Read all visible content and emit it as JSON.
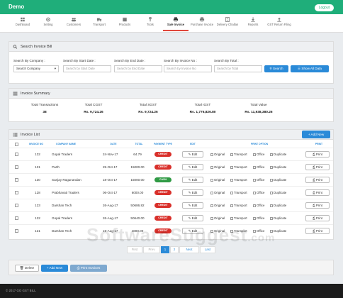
{
  "app": {
    "title": "Demo",
    "logout_label": "Logout"
  },
  "nav": [
    {
      "label": "Dashboard",
      "icon": "dashboard-icon"
    },
    {
      "label": "Setting",
      "icon": "gear-icon"
    },
    {
      "label": "Customers",
      "icon": "users-icon"
    },
    {
      "label": "Transport",
      "icon": "truck-icon"
    },
    {
      "label": "Products",
      "icon": "box-icon"
    },
    {
      "label": "Tools",
      "icon": "wrench-icon"
    },
    {
      "label": "Sale Invoice",
      "icon": "print-icon",
      "active": true
    },
    {
      "label": "Purchase Invoice",
      "icon": "print-icon"
    },
    {
      "label": "Delivery Challan",
      "icon": "doc-icon"
    },
    {
      "label": "Reports",
      "icon": "download-icon"
    },
    {
      "label": "GST Return Filing",
      "icon": "upload-icon"
    }
  ],
  "search": {
    "title": "Search Invoice Bill",
    "company_label": "Search By Company :",
    "company_value": "Search Company",
    "start_label": "Search By Start Date :",
    "start_placeholder": "Search by Start Date",
    "end_label": "Search By End Date :",
    "end_placeholder": "Search by End Date",
    "invoice_label": "Search By Invoice No :",
    "invoice_placeholder": "Search by Invoice No",
    "total_label": "Search By Total :",
    "total_placeholder": "Search by Total",
    "search_button": "Search",
    "show_all_button": "Show All Data"
  },
  "summary": {
    "title": "Invoice Summary",
    "items": [
      {
        "label": "Total Transactions",
        "value": "38"
      },
      {
        "label": "Total CGST",
        "value": "Rs. 9,724.26"
      },
      {
        "label": "Total SGST",
        "value": "Rs. 9,724.26"
      },
      {
        "label": "Total IGST",
        "value": "Rs. 1,776,826.80"
      },
      {
        "label": "Total Value",
        "value": "Rs. 11,938,380.26"
      }
    ]
  },
  "list": {
    "title": "Invoice List",
    "add_new_label": "+ Add New",
    "columns": [
      "INVOICE NO",
      "COMPANY NAME",
      "DATE",
      "TOTAL",
      "PAYMENT TYPE",
      "EDIT",
      "PRINT OPTION",
      "PRINT"
    ],
    "edit_label": "Edit",
    "print_label": "Print",
    "print_options": [
      "Original",
      "Transport",
      "Office",
      "Duplicate"
    ],
    "rows": [
      {
        "no": "132",
        "company": "Gopal Traders",
        "date": "24-Nov-17",
        "total": "64.79",
        "payment": "CREDIT"
      },
      {
        "no": "131",
        "company": "Parth",
        "date": "25-Oct-17",
        "total": "15000.00",
        "payment": "CREDIT"
      },
      {
        "no": "130",
        "company": "Sanjay Ragunandan",
        "date": "18-Oct-17",
        "total": "15000.00",
        "payment": "CASH"
      },
      {
        "no": "128",
        "company": "Prabhavati Traders",
        "date": "06-Oct-17",
        "total": "6000.00",
        "payment": "CREDIT"
      },
      {
        "no": "123",
        "company": "Darshan Tech",
        "date": "26-Aug-17",
        "total": "50686.82",
        "payment": "CREDIT"
      },
      {
        "no": "122",
        "company": "Gopal Traders",
        "date": "26-Aug-17",
        "total": "50640.00",
        "payment": "CREDIT"
      },
      {
        "no": "121",
        "company": "Darshan Tech",
        "date": "19-Aug-17",
        "total": "4800.00",
        "payment": "CREDIT"
      }
    ]
  },
  "pagination": {
    "first": "First",
    "prev": "Prev",
    "pages": [
      "1",
      "2"
    ],
    "next": "Next",
    "last": "Last"
  },
  "actions": {
    "delete": "Delete",
    "add_new": "+ Add New",
    "print_invoices": "Print Invoices"
  },
  "footer": {
    "text": "© 2017 GO GST BILL"
  },
  "watermark": {
    "main": "SoftwareSuggest",
    "suffix": ".com"
  },
  "colors": {
    "brand": "#1fae7a",
    "accent": "#2a8ad8",
    "credit": "#d9302b",
    "cash": "#2f9a44",
    "active_tab": "#e0473b"
  }
}
